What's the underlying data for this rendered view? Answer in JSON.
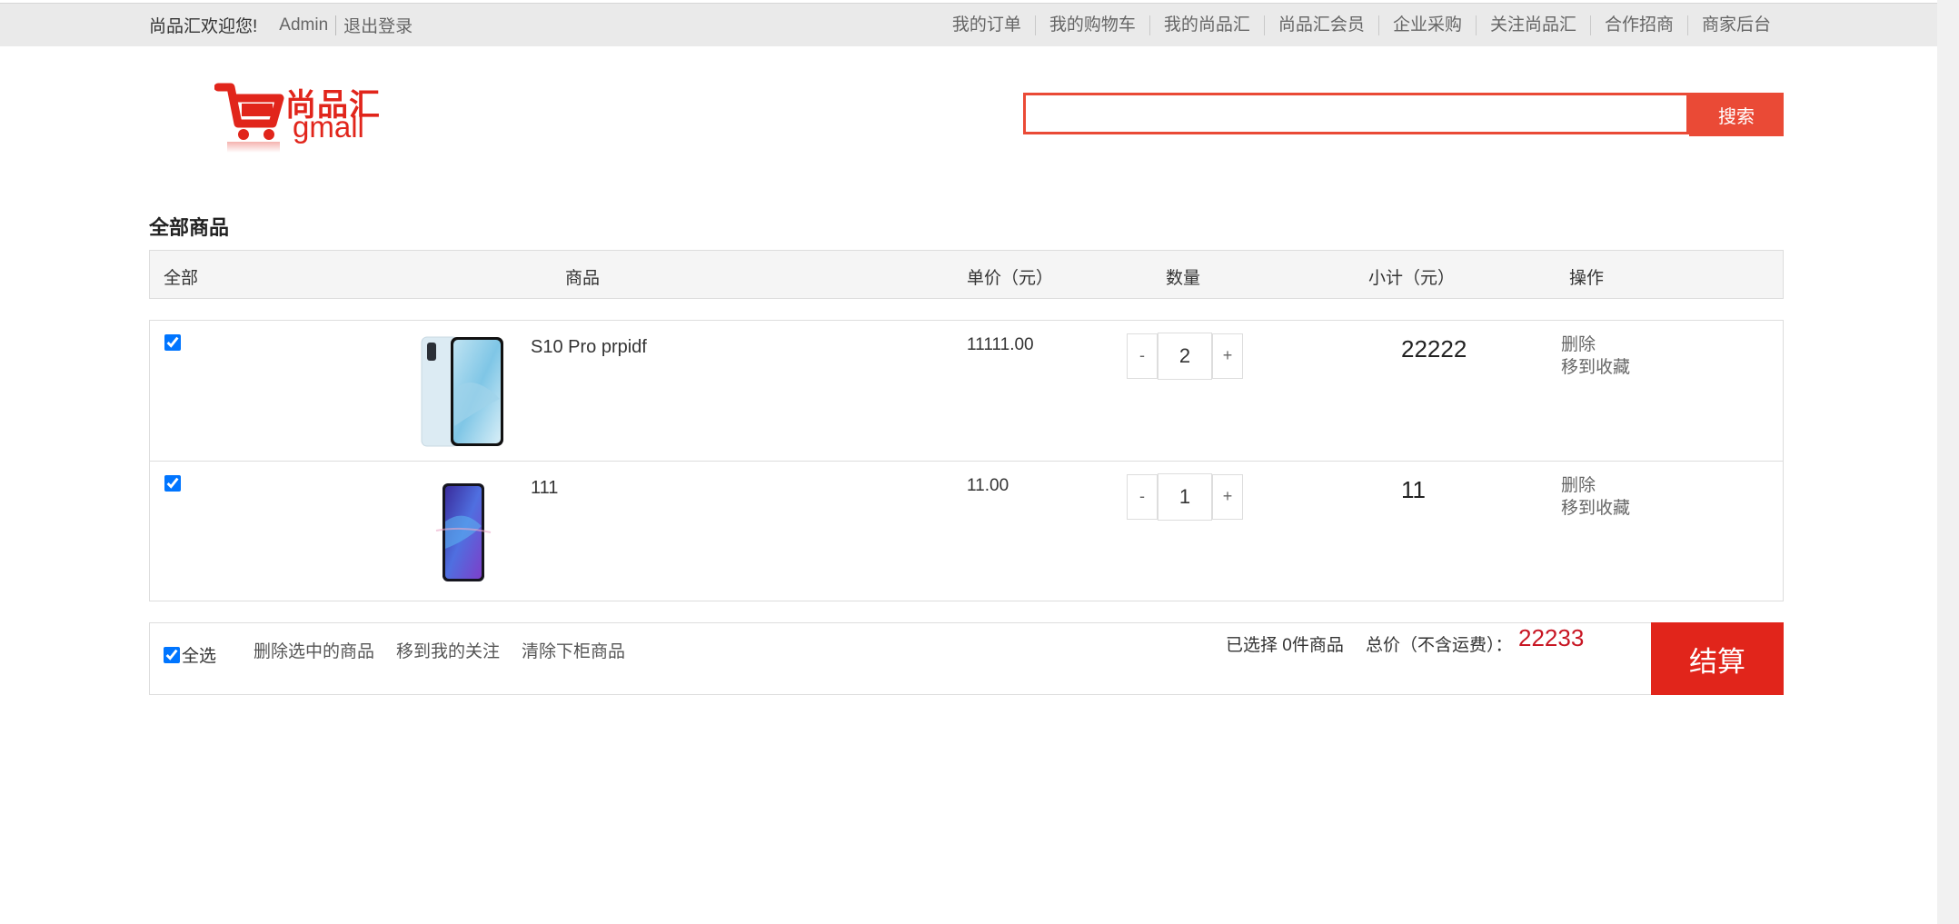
{
  "topbar": {
    "welcome": "尚品汇欢迎您!",
    "username": "Admin",
    "logout": "退出登录",
    "links": [
      "我的订单",
      "我的购物车",
      "我的尚品汇",
      "尚品汇会员",
      "企业采购",
      "关注尚品汇",
      "合作招商",
      "商家后台"
    ]
  },
  "header": {
    "logo_cn": "尚品汇",
    "logo_en": "gmall",
    "search_value": "",
    "search_button": "搜索"
  },
  "cart": {
    "title": "全部商品",
    "columns": {
      "all": "全部",
      "product": "商品",
      "unit_price": "单价（元）",
      "quantity": "数量",
      "subtotal": "小计（元）",
      "actions": "操作"
    },
    "items": [
      {
        "checked": true,
        "name": "S10 Pro prpidf",
        "price": "11111.00",
        "qty": "2",
        "subtotal": "22222",
        "delete": "删除",
        "favorite": "移到收藏"
      },
      {
        "checked": true,
        "name": "111",
        "price": "11.00",
        "qty": "1",
        "subtotal": "11",
        "delete": "删除",
        "favorite": "移到收藏"
      }
    ],
    "qty_minus": "-",
    "qty_plus": "+"
  },
  "footer": {
    "select_all": "全选",
    "select_all_checked": true,
    "delete_selected": "删除选中的商品",
    "move_to_follow": "移到我的关注",
    "clear_offshelf": "清除下柜商品",
    "selected_count": "已选择 0件商品",
    "total_label": "总价（不含运费）：",
    "total_value": "22233",
    "checkout": "结算"
  },
  "colors": {
    "brand_red": "#e1251b",
    "search_red": "#ea4a36",
    "price_red": "#c81623"
  }
}
